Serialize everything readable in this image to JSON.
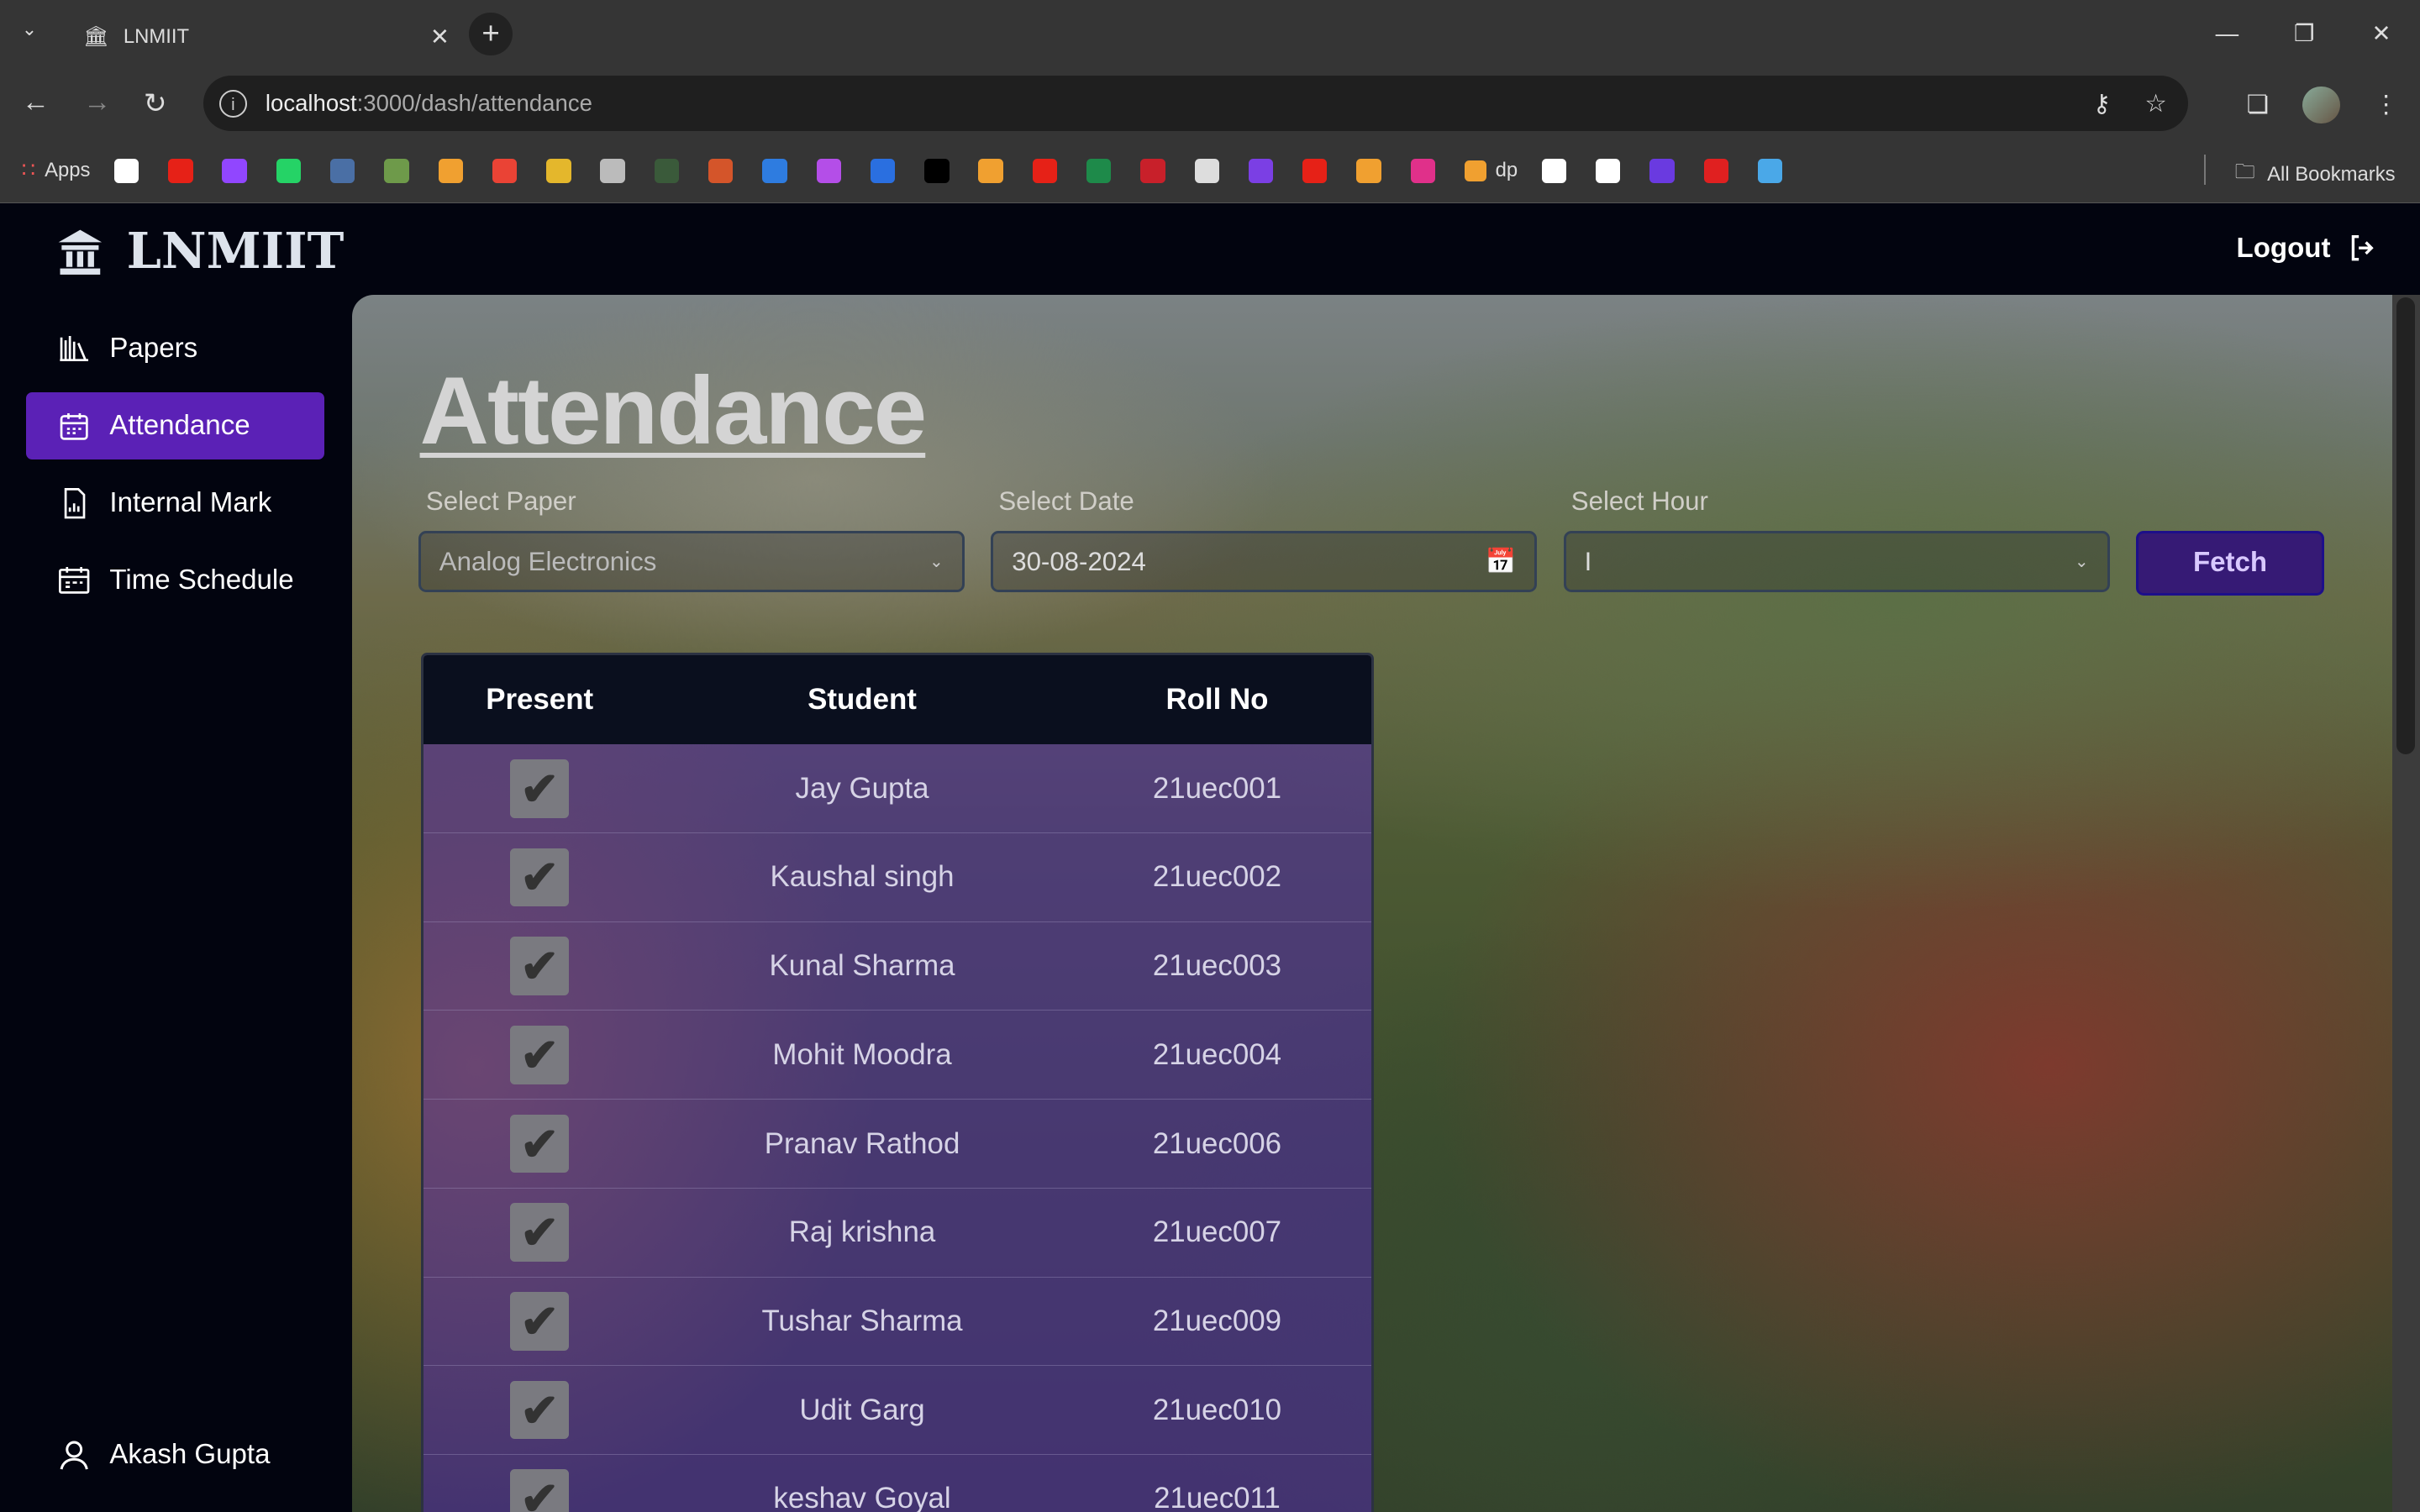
{
  "browser": {
    "tab_title": "LNMIIT",
    "new_tab": "+",
    "url_host": "localhost",
    "url_path": ":3000/dash/attendance",
    "bookmarks_apps": "Apps",
    "bookmarks": [
      {
        "icon": "google-icon",
        "color": "#ffffff"
      },
      {
        "icon": "youtube-icon",
        "color": "#e62117"
      },
      {
        "icon": "twitch-icon",
        "color": "#9146ff"
      },
      {
        "icon": "whatsapp-icon",
        "color": "#25d366"
      },
      {
        "icon": "bookmark-icon",
        "color": "#4a6fa5"
      },
      {
        "icon": "chess-icon",
        "color": "#6e9a4a"
      },
      {
        "icon": "codeforces-icon",
        "color": "#f0a030"
      },
      {
        "icon": "gmail-icon",
        "color": "#ea4335"
      },
      {
        "icon": "classroom-icon",
        "color": "#e4b72c"
      },
      {
        "icon": "notes-icon",
        "color": "#bbbbbb"
      },
      {
        "icon": "bookmark-icon",
        "color": "#3a5a3a"
      },
      {
        "icon": "x-mark-icon",
        "color": "#d4552a"
      },
      {
        "icon": "chart-icon",
        "color": "#2e7ce0"
      },
      {
        "icon": "umbrella-icon",
        "color": "#b44ee8"
      },
      {
        "icon": "bookmark-icon",
        "color": "#2a6fe0"
      },
      {
        "icon": "x-twitter-icon",
        "color": "#000000"
      },
      {
        "icon": "codeforces-icon",
        "color": "#f0a030"
      },
      {
        "icon": "youtube-icon",
        "color": "#e62117"
      },
      {
        "icon": "leaf-icon",
        "color": "#1e8a4a"
      },
      {
        "icon": "bookmark-icon",
        "color": "#c8202a"
      },
      {
        "icon": "box-icon",
        "color": "#dddddd"
      },
      {
        "icon": "bookmark-icon",
        "color": "#7b3fe4"
      },
      {
        "icon": "play-icon",
        "color": "#e62117"
      },
      {
        "icon": "codeforces-icon",
        "color": "#f0a030"
      },
      {
        "icon": "bookmark-icon",
        "color": "#e0308a"
      }
    ],
    "bookmark_dp": "dp",
    "bookmarks_after": [
      {
        "icon": "bookmark-icon",
        "color": "#ffffff"
      },
      {
        "icon": "github-icon",
        "color": "#ffffff"
      },
      {
        "icon": "bookmark-icon",
        "color": "#6a3ae0"
      },
      {
        "icon": "tuf-icon",
        "color": "#e02020"
      },
      {
        "icon": "bookmark-icon",
        "color": "#4aa8e8"
      }
    ],
    "all_bookmarks": "All Bookmarks"
  },
  "header": {
    "logo": "LNMIIT",
    "logout": "Logout"
  },
  "sidebar": {
    "items": [
      {
        "label": "Papers"
      },
      {
        "label": "Attendance",
        "active": true
      },
      {
        "label": "Internal Mark"
      },
      {
        "label": "Time Schedule"
      }
    ],
    "user": "Akash Gupta"
  },
  "main": {
    "title": "Attendance",
    "paper": {
      "label": "Select Paper",
      "value": "Analog Electronics"
    },
    "date": {
      "label": "Select Date",
      "value": "30-08-2024"
    },
    "hour": {
      "label": "Select Hour",
      "value": "I"
    },
    "fetch": "Fetch",
    "columns": [
      "Present",
      "Student",
      "Roll No"
    ],
    "rows": [
      {
        "present": true,
        "student": "Jay Gupta",
        "roll": "21uec001"
      },
      {
        "present": true,
        "student": "Kaushal singh",
        "roll": "21uec002"
      },
      {
        "present": true,
        "student": "Kunal Sharma",
        "roll": "21uec003"
      },
      {
        "present": true,
        "student": "Mohit Moodra",
        "roll": "21uec004"
      },
      {
        "present": true,
        "student": "Pranav Rathod",
        "roll": "21uec006"
      },
      {
        "present": true,
        "student": "Raj krishna",
        "roll": "21uec007"
      },
      {
        "present": true,
        "student": "Tushar Sharma",
        "roll": "21uec009"
      },
      {
        "present": true,
        "student": "Udit Garg",
        "roll": "21uec010"
      },
      {
        "present": true,
        "student": "keshav Goyal",
        "roll": "21uec011"
      }
    ]
  }
}
